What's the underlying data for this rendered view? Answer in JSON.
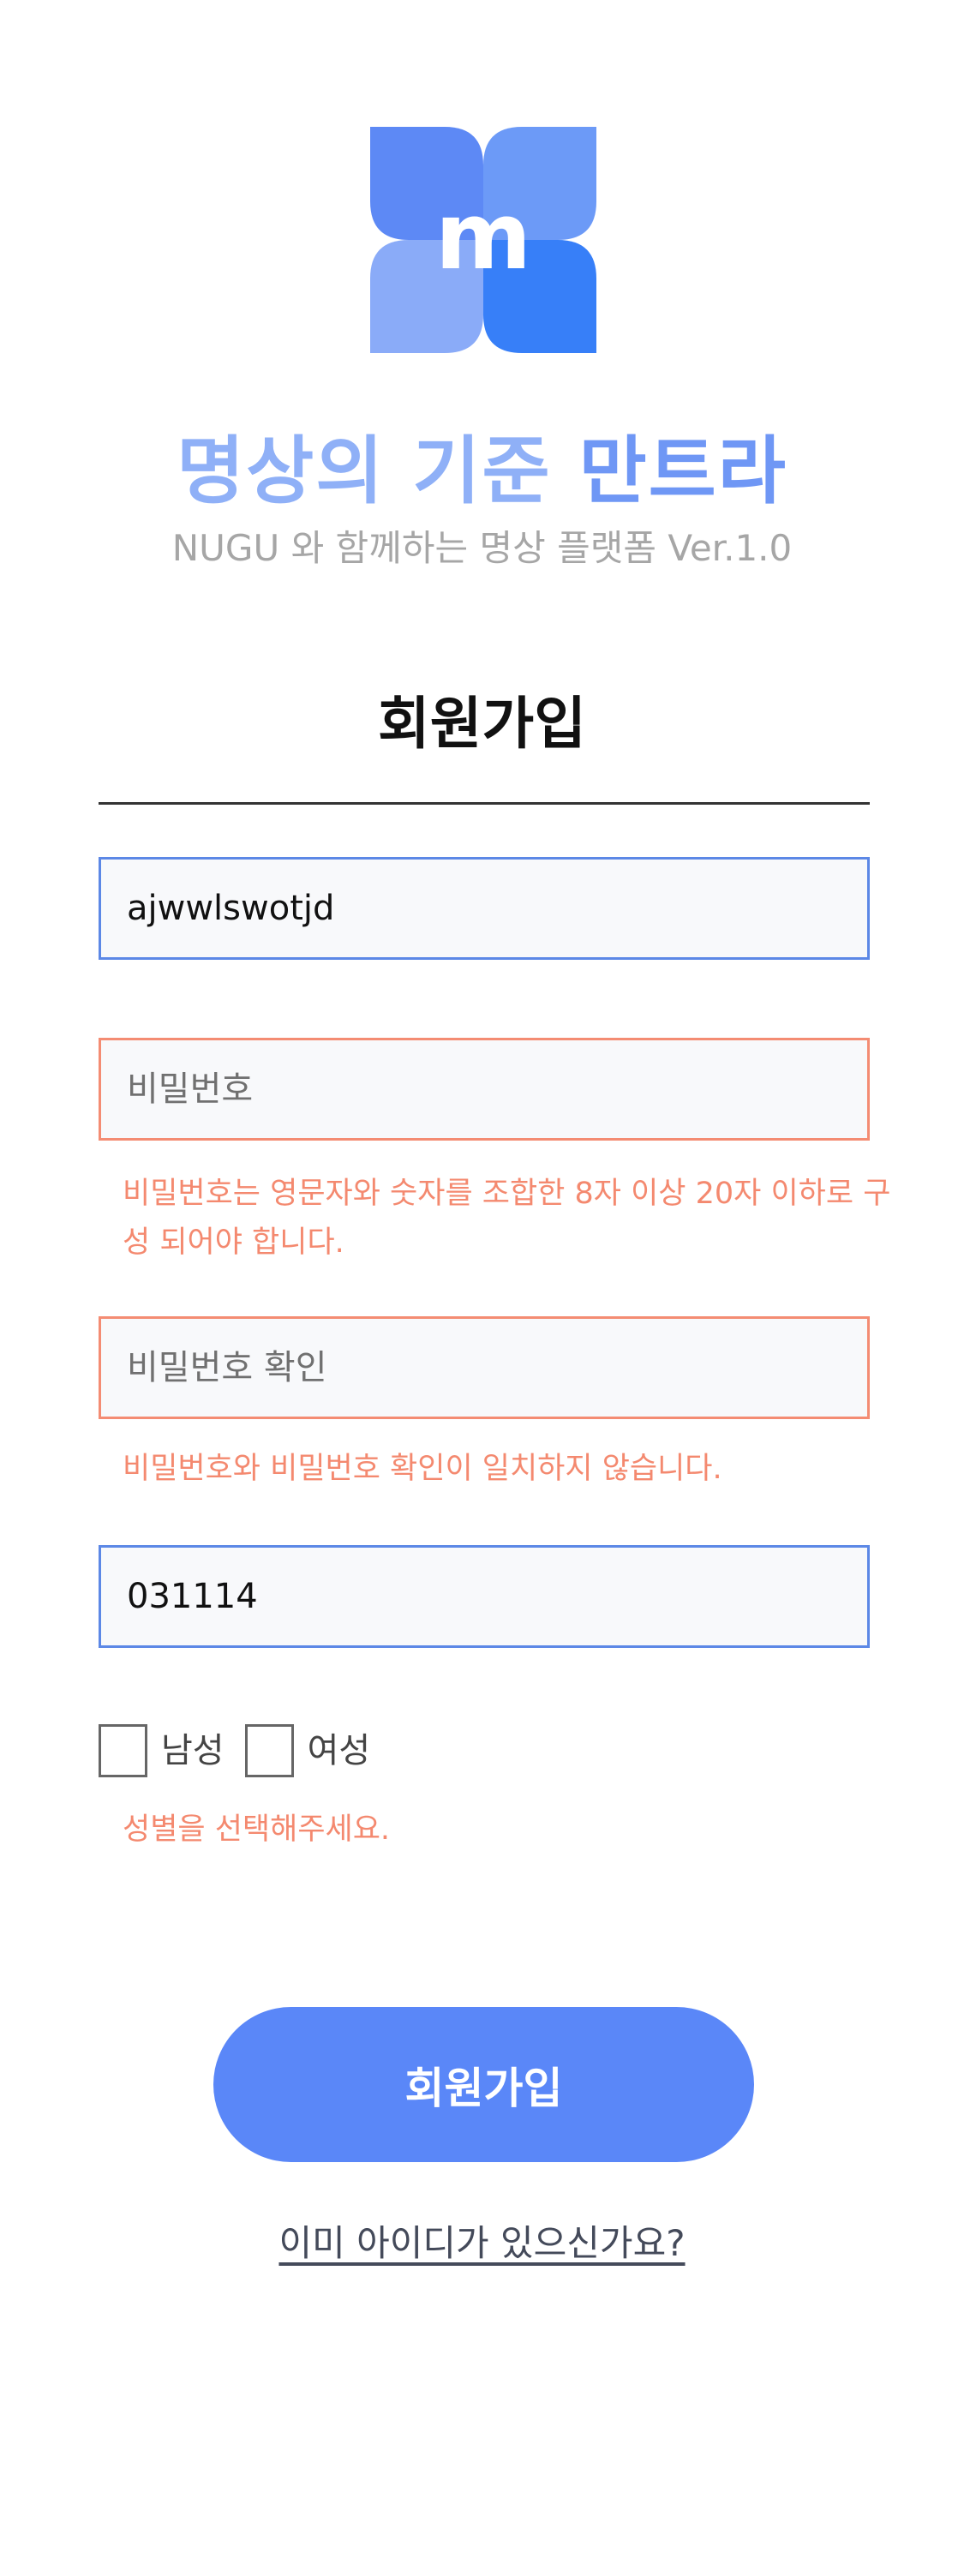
{
  "brand": {
    "logo_letter": "m",
    "title_part1": "명상의 기준",
    "title_part2": "만트라",
    "subtitle": "NUGU 와 함께하는 명상 플랫폼 Ver.1.0"
  },
  "form": {
    "heading": "회원가입",
    "id_field": {
      "value": "ajwwlswotjd",
      "placeholder": ""
    },
    "password_field": {
      "value": "",
      "placeholder": "비밀번호"
    },
    "password_error": "비밀번호는 영문자와 숫자를 조합한 8자 이상 20자 이하로 구성 되어야 합니다.",
    "password_confirm_field": {
      "value": "",
      "placeholder": "비밀번호 확인"
    },
    "password_confirm_error": "비밀번호와 비밀번호 확인이 일치하지 않습니다.",
    "birth_field": {
      "value": "031114",
      "placeholder": ""
    },
    "gender": {
      "male_label": "남성",
      "female_label": "여성",
      "error": "성별을 선택해주세요."
    },
    "submit_label": "회원가입",
    "login_link": "이미 아이디가 있으신가요?"
  },
  "colors": {
    "accent": "#5a87f8",
    "error": "#f4896f",
    "field_border": "#5c88e6"
  }
}
